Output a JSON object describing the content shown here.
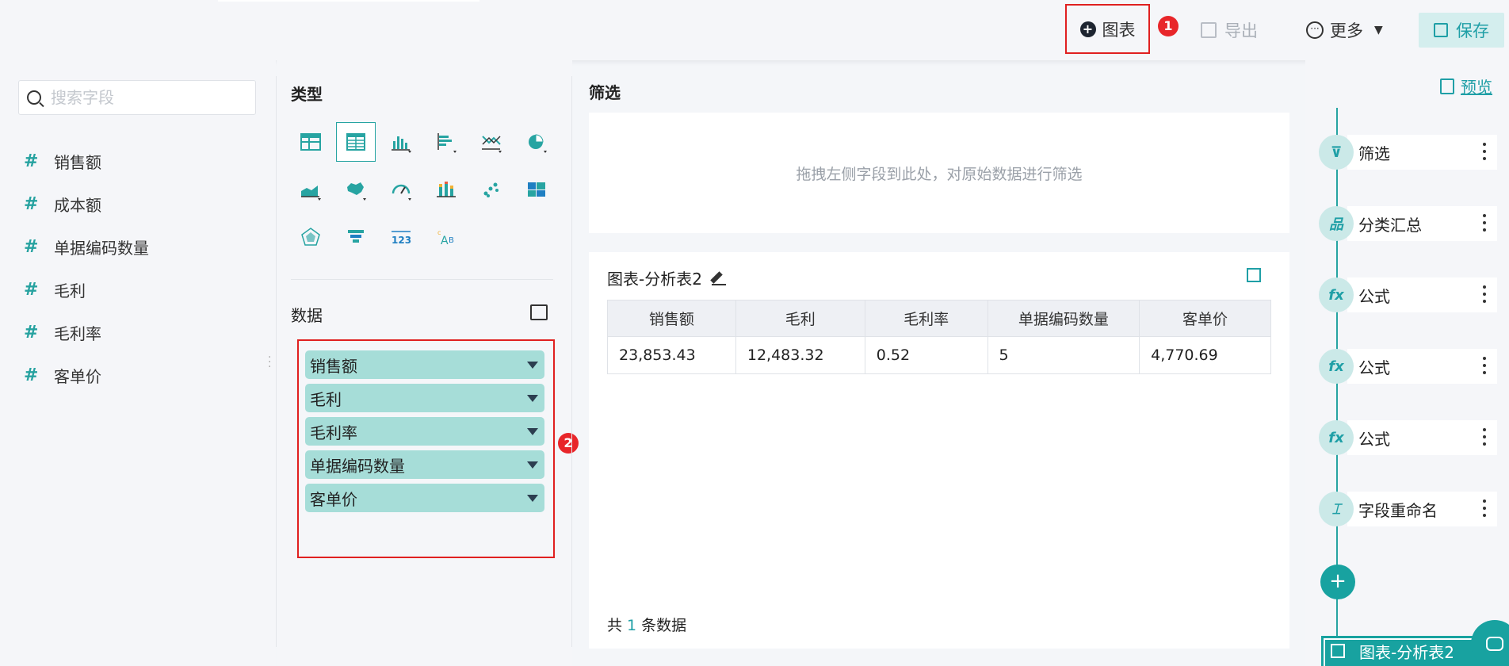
{
  "toolbar": {
    "chart_label": "图表",
    "badge1": "1",
    "export_label": "导出",
    "more_label": "更多",
    "save_label": "保存"
  },
  "search": {
    "placeholder": "搜索字段"
  },
  "fields": [
    {
      "label": "销售额"
    },
    {
      "label": "成本额"
    },
    {
      "label": "单据编码数量"
    },
    {
      "label": "毛利"
    },
    {
      "label": "毛利率"
    },
    {
      "label": "客单价"
    }
  ],
  "type_section": {
    "title": "类型",
    "icons": [
      "table-icon",
      "detail-table-icon",
      "bar-chart-icon",
      "horizontal-bar-icon",
      "line-chart-icon",
      "pie-chart-icon",
      "area-chart-icon",
      "map-icon",
      "gauge-icon",
      "stacked-bar-icon",
      "scatter-icon",
      "treemap-icon",
      "radar-icon",
      "funnel-icon",
      "kpi-number-icon",
      "word-cloud-icon"
    ]
  },
  "data_section": {
    "title": "数据",
    "badge2": "2",
    "chips": [
      {
        "label": "销售额"
      },
      {
        "label": "毛利"
      },
      {
        "label": "毛利率"
      },
      {
        "label": "单据编码数量"
      },
      {
        "label": "客单价"
      }
    ]
  },
  "filter": {
    "title": "筛选",
    "hint": "拖拽左侧字段到此处，对原始数据进行筛选"
  },
  "table": {
    "title": "图表-分析表2",
    "headers": [
      "销售额",
      "毛利",
      "毛利率",
      "单据编码数量",
      "客单价"
    ],
    "rows": [
      [
        "23,853.43",
        "12,483.32",
        "0.52",
        "5",
        "4,770.69"
      ]
    ],
    "footer_prefix": "共",
    "footer_count": "1",
    "footer_suffix": "条数据"
  },
  "steps": {
    "preview_label": "预览",
    "items": [
      {
        "label": "筛选",
        "icon": "filter-icon",
        "glyph": "⊽"
      },
      {
        "label": "分类汇总",
        "icon": "group-summary-icon",
        "glyph": "品"
      },
      {
        "label": "公式",
        "icon": "formula-icon",
        "glyph": "fx"
      },
      {
        "label": "公式",
        "icon": "formula-icon",
        "glyph": "fx"
      },
      {
        "label": "公式",
        "icon": "formula-icon",
        "glyph": "fx"
      },
      {
        "label": "字段重命名",
        "icon": "rename-icon",
        "glyph": "⌶"
      }
    ],
    "add_label": "+",
    "bottom_tab_label": "图表-分析表2"
  },
  "colors": {
    "accent": "#18a2a0",
    "chip_bg": "#a6ddd8",
    "highlight_red": "#e02020"
  }
}
